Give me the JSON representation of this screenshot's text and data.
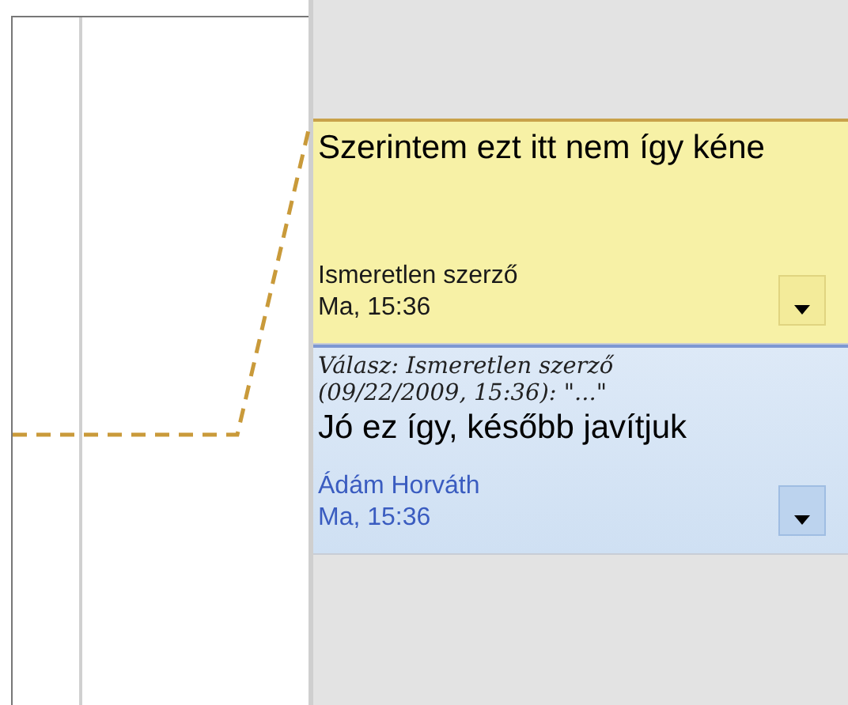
{
  "comments": [
    {
      "kind": "comment",
      "text": "Szerintem ezt itt nem így kéne",
      "author": "Ismeretlen szerző",
      "time": "Ma, 15:36"
    },
    {
      "kind": "reply",
      "quote": "Válasz: Ismeretlen szerző (09/22/2009, 15:36): \"...\"",
      "text": "Jó ez így, később javítjuk",
      "author": "Ádám Horváth",
      "time": "Ma, 15:36"
    }
  ]
}
